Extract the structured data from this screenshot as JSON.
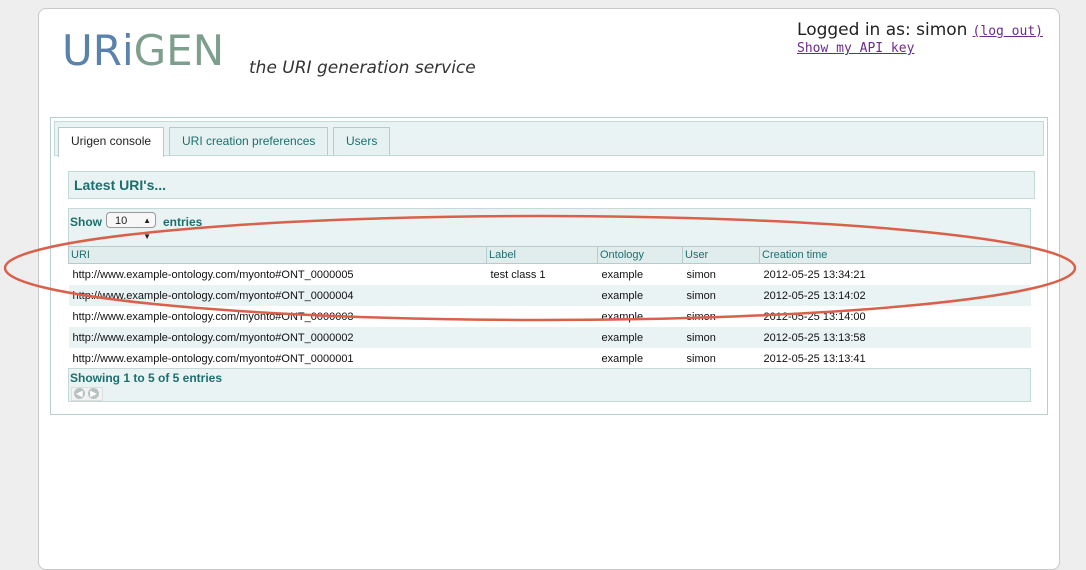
{
  "header": {
    "logo": {
      "part1": "UR",
      "part2": "i",
      "part3": "GEN"
    },
    "tagline": "the URI generation service",
    "login_text": "Logged in as: simon",
    "logout_label": "(log out)",
    "api_key_label": "Show my API key"
  },
  "tabs": [
    {
      "label": "Urigen console",
      "active": true
    },
    {
      "label": "URI creation preferences",
      "active": false
    },
    {
      "label": "Users",
      "active": false
    }
  ],
  "section_title": "Latest URI's...",
  "length_control": {
    "show_label": "Show",
    "selected": "10",
    "entries_label": "entries"
  },
  "table": {
    "columns": [
      "URI",
      "Label",
      "Ontology",
      "User",
      "Creation time"
    ],
    "rows": [
      [
        "http://www.example-ontology.com/myonto#ONT_0000005",
        "test class 1",
        "example",
        "simon",
        "2012-05-25 13:34:21"
      ],
      [
        "http://www.example-ontology.com/myonto#ONT_0000004",
        "",
        "example",
        "simon",
        "2012-05-25 13:14:02"
      ],
      [
        "http://www.example-ontology.com/myonto#ONT_0000003",
        "",
        "example",
        "simon",
        "2012-05-25 13:14:00"
      ],
      [
        "http://www.example-ontology.com/myonto#ONT_0000002",
        "",
        "example",
        "simon",
        "2012-05-25 13:13:58"
      ],
      [
        "http://www.example-ontology.com/myonto#ONT_0000001",
        "",
        "example",
        "simon",
        "2012-05-25 13:13:41"
      ]
    ]
  },
  "footer": {
    "info": "Showing 1 to 5 of 5 entries",
    "prev_icon": "arrow-left-icon",
    "next_icon": "arrow-right-icon"
  },
  "colors": {
    "accent": "#1d6f6f",
    "panel_bg": "#eaf3f3",
    "annotation": "#d9604a",
    "link": "#6b2a8c"
  }
}
